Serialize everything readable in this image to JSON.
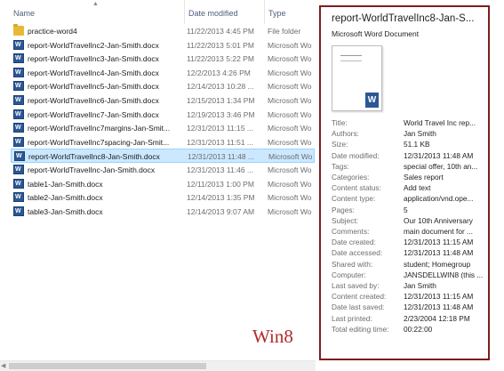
{
  "columns": {
    "name": "Name",
    "date": "Date modified",
    "type": "Type"
  },
  "files": [
    {
      "name": "practice-word4",
      "date": "11/22/2013 4:45 PM",
      "type": "File folder",
      "icon": "folder-icon",
      "selected": false
    },
    {
      "name": "report-WorldTravelInc2-Jan-Smith.docx",
      "date": "11/22/2013 5:01 PM",
      "type": "Microsoft Wo",
      "icon": "word-doc-icon",
      "selected": false
    },
    {
      "name": "report-WorldTravelInc3-Jan-Smith.docx",
      "date": "11/22/2013 5:22 PM",
      "type": "Microsoft Wo",
      "icon": "word-doc-icon",
      "selected": false
    },
    {
      "name": "report-WorldTravelInc4-Jan-Smith.docx",
      "date": "12/2/2013 4:26 PM",
      "type": "Microsoft Wo",
      "icon": "word-doc-icon",
      "selected": false
    },
    {
      "name": "report-WorldTravelInc5-Jan-Smith.docx",
      "date": "12/14/2013 10:28 ...",
      "type": "Microsoft Wo",
      "icon": "word-doc-icon",
      "selected": false
    },
    {
      "name": "report-WorldTravelInc6-Jan-Smith.docx",
      "date": "12/15/2013 1:34 PM",
      "type": "Microsoft Wo",
      "icon": "word-doc-icon",
      "selected": false
    },
    {
      "name": "report-WorldTravelInc7-Jan-Smith.docx",
      "date": "12/19/2013 3:46 PM",
      "type": "Microsoft Wo",
      "icon": "word-doc-icon",
      "selected": false
    },
    {
      "name": "report-WorldTravelInc7margins-Jan-Smit...",
      "date": "12/31/2013 11:15 ...",
      "type": "Microsoft Wo",
      "icon": "word-doc-icon",
      "selected": false
    },
    {
      "name": "report-WorldTravelInc7spacing-Jan-Smit...",
      "date": "12/31/2013 11:51 ...",
      "type": "Microsoft Wo",
      "icon": "word-doc-icon",
      "selected": false
    },
    {
      "name": "report-WorldTravelInc8-Jan-Smith.docx",
      "date": "12/31/2013 11:48 ...",
      "type": "Microsoft Wo",
      "icon": "word-doc-icon",
      "selected": true
    },
    {
      "name": "report-WorldTravelInc-Jan-Smith.docx",
      "date": "12/31/2013 11:46 ...",
      "type": "Microsoft Wo",
      "icon": "word-doc-icon",
      "selected": false
    },
    {
      "name": "table1-Jan-Smith.docx",
      "date": "12/11/2013 1:00 PM",
      "type": "Microsoft Wo",
      "icon": "word-doc-icon",
      "selected": false
    },
    {
      "name": "table2-Jan-Smith.docx",
      "date": "12/14/2013 1:35 PM",
      "type": "Microsoft Wo",
      "icon": "word-doc-icon",
      "selected": false
    },
    {
      "name": "table3-Jan-Smith.docx",
      "date": "12/14/2013 9:07 AM",
      "type": "Microsoft Wo",
      "icon": "word-doc-icon",
      "selected": false
    }
  ],
  "details": {
    "title": "report-WorldTravelInc8-Jan-S...",
    "subtitle": "Microsoft Word Document",
    "thumbnail_icon": "word-thumbnail-icon",
    "properties": [
      {
        "key": "Title:",
        "value": "World Travel Inc rep..."
      },
      {
        "key": "Authors:",
        "value": "Jan Smith"
      },
      {
        "key": "Size:",
        "value": "51.1 KB"
      },
      {
        "key": "Date modified:",
        "value": "12/31/2013 11:48 AM"
      },
      {
        "key": "Tags:",
        "value": "special offer, 10th an..."
      },
      {
        "key": "Categories:",
        "value": "Sales report"
      },
      {
        "key": "Content status:",
        "value": "Add text"
      },
      {
        "key": "Content type:",
        "value": "application/vnd.ope..."
      },
      {
        "key": "Pages:",
        "value": "5"
      },
      {
        "key": "Subject:",
        "value": "Our 10th Anniversary"
      },
      {
        "key": "Comments:",
        "value": "main document for ..."
      },
      {
        "key": "Date created:",
        "value": "12/31/2013 11:15 AM"
      },
      {
        "key": "Date accessed:",
        "value": "12/31/2013 11:48 AM"
      },
      {
        "key": "Shared with:",
        "value": "student; Homegroup"
      },
      {
        "key": "Computer:",
        "value": "JANSDELLWIN8 (this ..."
      },
      {
        "key": "Last saved by:",
        "value": "Jan Smith"
      },
      {
        "key": "Content created:",
        "value": "12/31/2013 11:15 AM"
      },
      {
        "key": "Date last saved:",
        "value": "12/31/2013 11:48 AM"
      },
      {
        "key": "Last printed:",
        "value": "2/23/2004 12:18 PM"
      },
      {
        "key": "Total editing time:",
        "value": "00:22:00"
      }
    ]
  },
  "watermark": "Win8",
  "colors": {
    "selection": "#cce8ff",
    "accent_border": "#7d1d1d",
    "watermark": "#b22a2a"
  }
}
